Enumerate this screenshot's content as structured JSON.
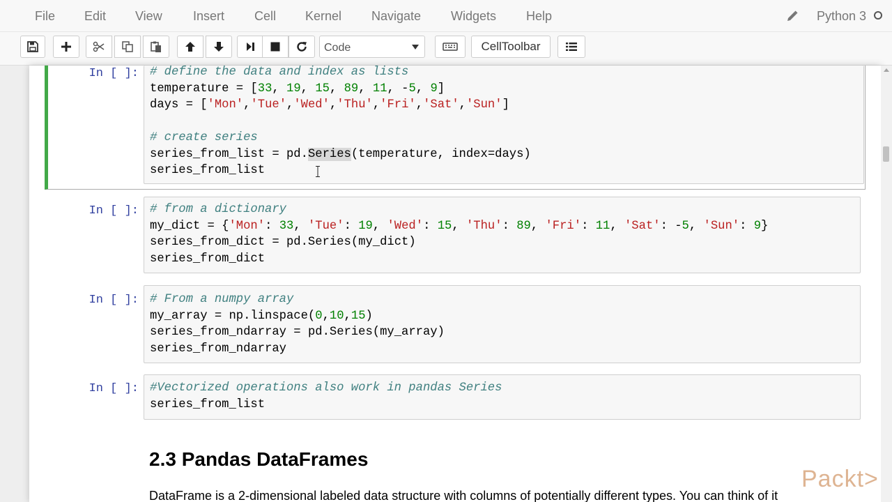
{
  "menubar": {
    "items": [
      "File",
      "Edit",
      "View",
      "Insert",
      "Cell",
      "Kernel",
      "Navigate",
      "Widgets",
      "Help"
    ],
    "kernel_name": "Python 3"
  },
  "toolbar": {
    "cell_type": "Code",
    "celltoolbar_label": "CellToolbar"
  },
  "cells": [
    {
      "prompt": "In [ ]:",
      "lines": [
        "# define the data and index as lists",
        "temperature = [33, 19, 15, 89, 11, -5, 9]",
        "days = ['Mon','Tue','Wed','Thu','Fri','Sat','Sun']",
        "",
        "# create series",
        "series_from_list = pd.Series(temperature, index=days)",
        "series_from_list"
      ]
    },
    {
      "prompt": "In [ ]:",
      "lines": [
        "# from a dictionary",
        "my_dict = {'Mon': 33, 'Tue': 19, 'Wed': 15, 'Thu': 89, 'Fri': 11, 'Sat': -5, 'Sun': 9}",
        "series_from_dict = pd.Series(my_dict)",
        "series_from_dict"
      ]
    },
    {
      "prompt": "In [ ]:",
      "lines": [
        "# From a numpy array",
        "my_array = np.linspace(0,10,15)",
        "series_from_ndarray = pd.Series(my_array)",
        "series_from_ndarray"
      ]
    },
    {
      "prompt": "In [ ]:",
      "lines": [
        "#Vectorized operations also work in pandas Series",
        "series_from_list"
      ]
    }
  ],
  "markdown": {
    "heading": "2.3  Pandas DataFrames",
    "paragraph": "DataFrame is a 2-dimensional labeled data structure with columns of potentially different types. You can think of it"
  },
  "watermark": "Packt>",
  "colors": {
    "selected_cell_border": "#42a948",
    "prompt": "#303f9f",
    "comment": "#408080",
    "string": "#ba2121",
    "number": "#008000"
  }
}
